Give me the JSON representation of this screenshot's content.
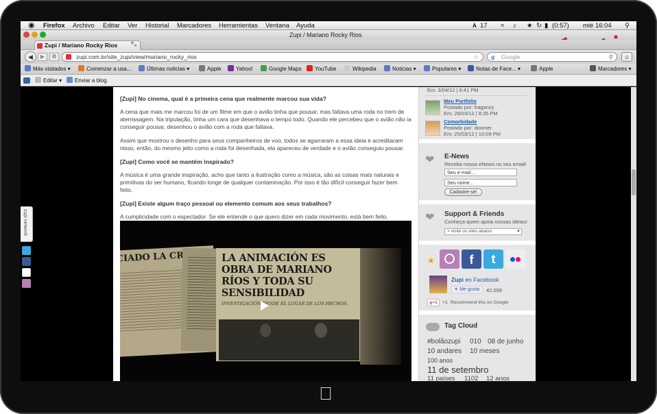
{
  "menubar": {
    "app": "Firefox",
    "items": [
      "Archivo",
      "Editar",
      "Ver",
      "Historial",
      "Marcadores",
      "Herramientas",
      "Ventana",
      "Ayuda"
    ],
    "status": {
      "badge": "17",
      "battery": "(0:57)",
      "clock": "mié 16:04"
    }
  },
  "window": {
    "title": "Zupi / Mariano Rocky Rios"
  },
  "tab": {
    "label": "Zupi / Mariano Rocky Rios",
    "new_tab": "+"
  },
  "nav": {
    "url": "zupi.com.br/site_zupi/view/mariano_rocky_rios",
    "search_placeholder": "Google"
  },
  "bookmarks": [
    "Más visitados",
    "Comenzar a usa...",
    "Últimas noticias",
    "Apple",
    "Yahoo!",
    "Google Maps",
    "YouTube",
    "Wikipedia",
    "Noticias",
    "Populares",
    "Notas de Face...",
    "Apple",
    "Marcadores"
  ],
  "toolbar2": {
    "edit": "Editar",
    "send": "Enviar a blog"
  },
  "side_widget": {
    "label": "zupi network"
  },
  "article": {
    "q1": "[Zupi] No cinema, qual é a primeira cena que realmente marcou sua vida?",
    "a1": "A cena que mais me marcou foi de um filme em que o avião tinha que pousar, mas faltava uma roda no trem de aterrissagem. Na tripulação, tinha um cara que desenhava o tempo todo. Quando ele percebeu que o avião não ia conseguir pousar, desenhou o avião com a roda que faltava.",
    "a1b": "Assim que mostrou o desenho para seus companheiros de voo, todos se agarraram a essa ideia e acreditaram nisso, então, do mesmo jeito como a roda foi desenhada, ela apareceu de verdade e o avião conseguiu pousar.",
    "q2": "[Zupi] Como você se mantém inspirado?",
    "a2": "A música é uma grande inspiração, acho que tanto a ilustração como a música, são as coisas mais naturais e primitivas do ser humano, ficando longe de qualquer contaminação. Por isso é tão difícil conseguir fazer bem feito.",
    "q3": "[Zupi] Existe algum traço pessoal ou elemento comum aos seus trabalhos?",
    "a3": "A cumplicidade com o espectador. Se ele entende o que quero dizer em cada movimento, está bem feito."
  },
  "video": {
    "headline": "LA ANIMACIÓN ES OBRA DE MARIANO RÍOS Y TODA SU SENSIBILIDAD",
    "subhead": "INVESTIGACIÓN DESDE EL LUGAR DE LOS HECHOS.",
    "left_head": "CIADO LA CRISIS"
  },
  "sidebar": {
    "top_date": "Em: 3/04/12 | 6:41 PM",
    "comments": [
      {
        "title": "Meu Portfolio",
        "by": "Postado por: fraganzy",
        "date": "Em: 28/03/12 | 8:35 PM"
      },
      {
        "title": "Comorbidade",
        "by": "Postado por: doomer",
        "date": "Em: 25/03/12 | 10:09 PM"
      }
    ],
    "enews": {
      "title": "E-News",
      "sub": "Receba nossa eNews no seu email!",
      "email_placeholder": "Seu e-mail...",
      "name_placeholder": "Seu nome...",
      "button": "Cadastre-se!"
    },
    "support": {
      "title": "Support & Friends",
      "sub": "Conheça quem apoia nossas ideias!",
      "select": "> visite os sites abaixo"
    },
    "facebook": {
      "name": "Zupi",
      "on": "en Facebook",
      "like": "Me gusta",
      "count": "42,599"
    },
    "gplus": {
      "count": "+1",
      "text": "Recommend this on Google"
    },
    "tagcloud": {
      "title": "Tag Cloud",
      "tags": [
        "#bolãozupi",
        "010",
        "08 de junho",
        "10 andares",
        "10 meses",
        "100 anos",
        "11 de setembro",
        "11 países",
        "1102",
        "12 anos"
      ]
    }
  },
  "colors": {
    "link": "#1b5fa6",
    "accent": "#3a7fc0"
  }
}
